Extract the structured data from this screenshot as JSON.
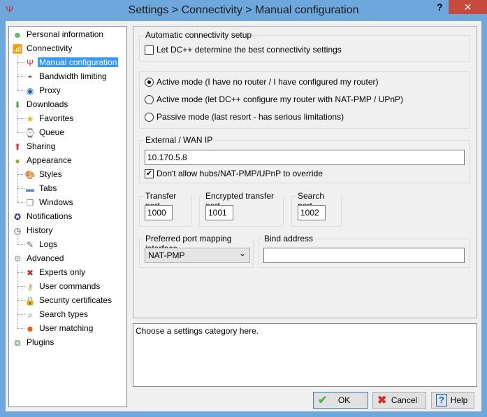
{
  "window": {
    "title": "Settings > Connectivity > Manual configuration",
    "help_glyph": "?",
    "close_glyph": "✕"
  },
  "tree": [
    {
      "label": "Personal information",
      "level": 0,
      "icon": "user-icon",
      "color": "#4caf50",
      "glyph": "☻"
    },
    {
      "label": "Connectivity",
      "level": 0,
      "icon": "antenna-icon",
      "color": "#d84315",
      "glyph": "📶"
    },
    {
      "label": "Manual configuration",
      "level": 1,
      "icon": "antenna-icon",
      "color": "#c0392b",
      "glyph": "Ψ",
      "selected": true
    },
    {
      "label": "Bandwidth limiting",
      "level": 1,
      "icon": "gauge-icon",
      "color": "#555",
      "glyph": "◓"
    },
    {
      "label": "Proxy",
      "level": 1,
      "icon": "globe-icon",
      "color": "#1565c0",
      "glyph": "◉"
    },
    {
      "label": "Downloads",
      "level": 0,
      "icon": "arrow-down-icon",
      "color": "#43a047",
      "glyph": "⬇"
    },
    {
      "label": "Favorites",
      "level": 1,
      "icon": "star-icon",
      "color": "#f4b400",
      "glyph": "★"
    },
    {
      "label": "Queue",
      "level": 1,
      "icon": "queue-icon",
      "color": "#558b2f",
      "glyph": "⌚"
    },
    {
      "label": "Sharing",
      "level": 0,
      "icon": "arrow-up-icon",
      "color": "#d32f2f",
      "glyph": "⬆"
    },
    {
      "label": "Appearance",
      "level": 0,
      "icon": "appearance-icon",
      "color": "#9e9d24",
      "glyph": "●"
    },
    {
      "label": "Styles",
      "level": 1,
      "icon": "palette-icon",
      "color": "#c68a2f",
      "glyph": "🎨"
    },
    {
      "label": "Tabs",
      "level": 1,
      "icon": "tabs-icon",
      "color": "#5b8fc9",
      "glyph": "▬"
    },
    {
      "label": "Windows",
      "level": 1,
      "icon": "windows-icon",
      "color": "#777",
      "glyph": "❐"
    },
    {
      "label": "Notifications",
      "level": 0,
      "icon": "notifications-icon",
      "color": "#1a237e",
      "glyph": "✪"
    },
    {
      "label": "History",
      "level": 0,
      "icon": "clock-icon",
      "color": "#333",
      "glyph": "◷"
    },
    {
      "label": "Logs",
      "level": 1,
      "icon": "log-icon",
      "color": "#666",
      "glyph": "✎"
    },
    {
      "label": "Advanced",
      "level": 0,
      "icon": "gear-icon",
      "color": "#999",
      "glyph": "⚙"
    },
    {
      "label": "Experts only",
      "level": 1,
      "icon": "tools-icon",
      "color": "#c62828",
      "glyph": "✖"
    },
    {
      "label": "User commands",
      "level": 1,
      "icon": "key-icon",
      "color": "#c79a00",
      "glyph": "⚷"
    },
    {
      "label": "Security certificates",
      "level": 1,
      "icon": "lock-icon",
      "color": "#c79a00",
      "glyph": "🔒"
    },
    {
      "label": "Search types",
      "level": 1,
      "icon": "search-icon",
      "color": "#1565c0",
      "glyph": "⌕"
    },
    {
      "label": "User matching",
      "level": 1,
      "icon": "users-icon",
      "color": "#e65100",
      "glyph": "☻"
    },
    {
      "label": "Plugins",
      "level": 0,
      "icon": "plugins-icon",
      "color": "#2e7d32",
      "glyph": "⧉"
    }
  ],
  "auto": {
    "legend": "Automatic connectivity setup",
    "checkbox": "Let DC++ determine the best connectivity settings",
    "checked": false
  },
  "modes": [
    {
      "label": "Active mode (I have no router / I have configured my router)",
      "selected": true
    },
    {
      "label": "Active mode (let DC++ configure my router with NAT-PMP / UPnP)",
      "selected": false
    },
    {
      "label": "Passive mode (last resort - has serious limitations)",
      "selected": false
    }
  ],
  "wan": {
    "legend": "External / WAN IP",
    "value": "10.170.5.8",
    "override_label": "Don't allow hubs/NAT-PMP/UPnP to override",
    "override_checked": true,
    "check_glyph": "✔"
  },
  "ports": {
    "transfer_label": "Transfer port",
    "transfer": "1000",
    "encrypted_label": "Encrypted transfer port",
    "encrypted": "1001",
    "search_label": "Search port",
    "search": "1002"
  },
  "mapping": {
    "legend": "Preferred port mapping interface",
    "value": "NAT-PMP",
    "chevron": "⌄"
  },
  "bind": {
    "legend": "Bind address",
    "value": ""
  },
  "description": "Choose a settings category here.",
  "buttons": {
    "ok": "OK",
    "cancel": "Cancel",
    "help": "Help",
    "ok_glyph": "✔",
    "cancel_glyph": "✖",
    "help_glyph": "?"
  }
}
